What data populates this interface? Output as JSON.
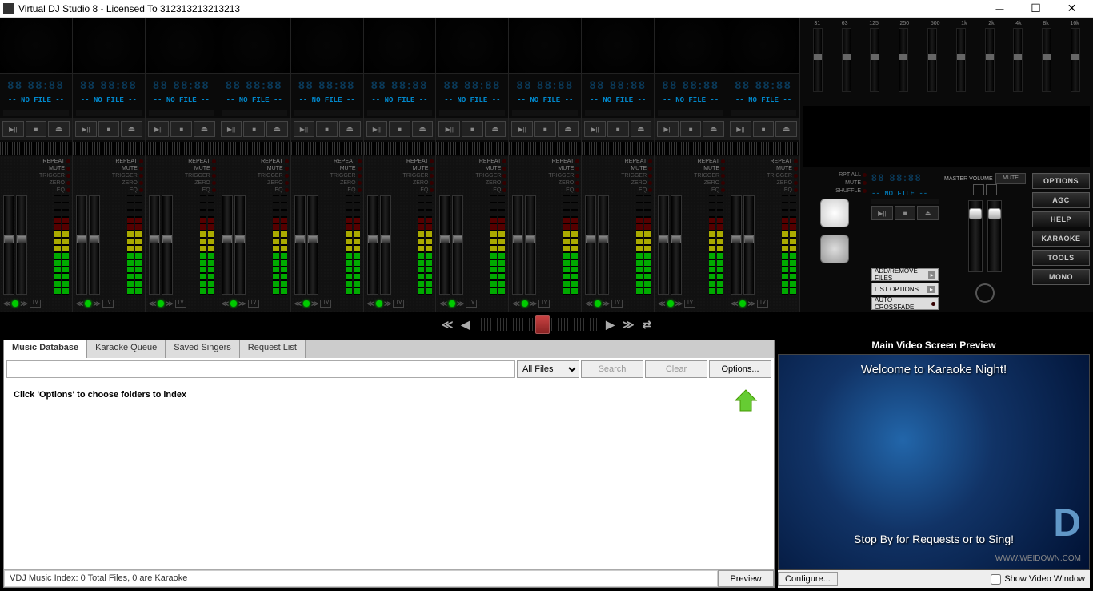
{
  "titlebar": {
    "title": "Virtual DJ Studio 8 - Licensed To 312313213213213"
  },
  "channel": {
    "bpm_display": "88:88:88",
    "no_file": "-- NO FILE --",
    "labels": {
      "repeat": "REPEAT",
      "mute": "MUTE",
      "trigger": "TRIGGER",
      "zero": "ZERO",
      "eq": "EQ"
    },
    "tv": "TV"
  },
  "right": {
    "eq_bands": [
      "31",
      "63",
      "125",
      "250",
      "500",
      "1k",
      "2k",
      "4k",
      "8k",
      "16k"
    ],
    "rpt_all": "RPT ALL",
    "mute": "MUTE",
    "shuffle": "SHUFFLE",
    "add_remove": "ADD/REMOVE FILES",
    "list_options": "LIST OPTIONS",
    "auto_crossfade": "AUTO CROSSFADE",
    "master_volume": "MASTER VOLUME",
    "mute_btn": "MUTE",
    "buttons": {
      "options": "OPTIONS",
      "agc": "AGC",
      "help": "HELP",
      "karaoke": "KARAOKE",
      "tools": "TOOLS",
      "mono": "MONO"
    }
  },
  "tabs": {
    "music_db": "Music Database",
    "karaoke_queue": "Karaoke Queue",
    "saved_singers": "Saved Singers",
    "request_list": "Request List"
  },
  "search": {
    "all_files": "All Files",
    "search": "Search",
    "clear": "Clear",
    "options": "Options..."
  },
  "db": {
    "message": "Click 'Options' to choose folders to index",
    "status": "VDJ Music Index: 0 Total Files, 0 are Karaoke",
    "preview": "Preview"
  },
  "video": {
    "title": "Main Video Screen Preview",
    "welcome": "Welcome to Karaoke Night!",
    "subtitle": "Stop By for Requests or to Sing!",
    "configure": "Configure...",
    "show_window": "Show Video Window",
    "watermark_url": "WWW.WEIDOWN.COM"
  }
}
